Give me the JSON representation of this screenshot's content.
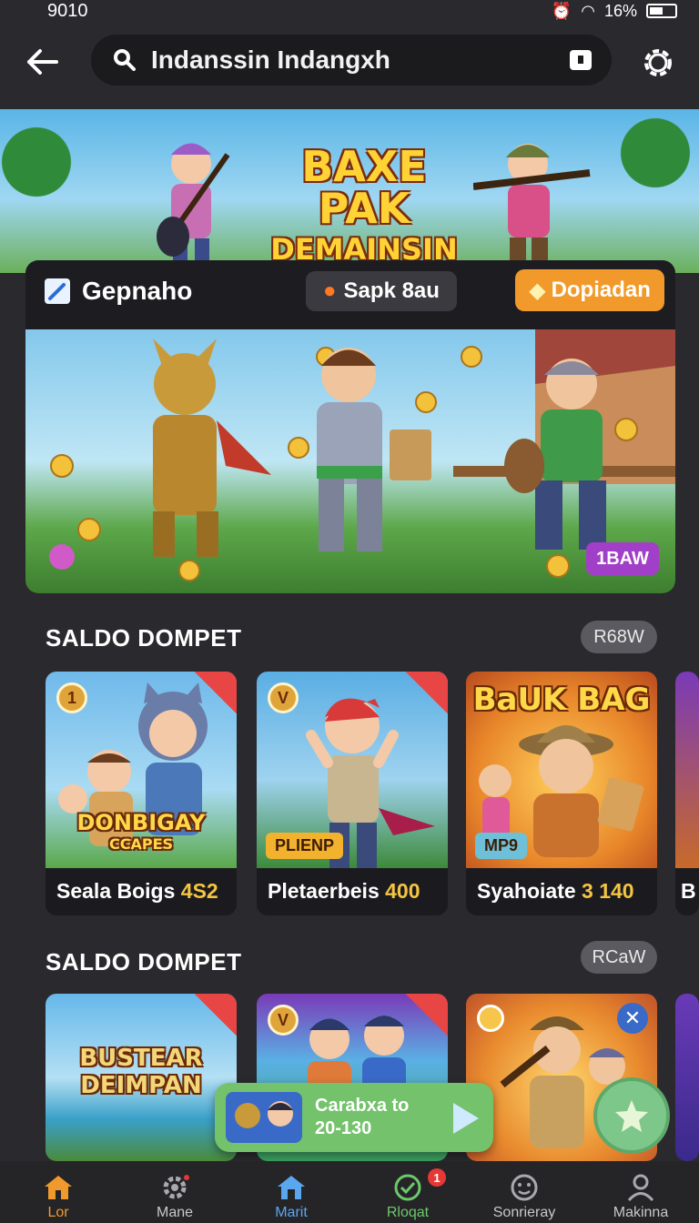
{
  "status": {
    "time": "9010",
    "battery": "16%"
  },
  "search": {
    "query": "Indanssin Indangxh"
  },
  "hero": {
    "line1": "BAXE PAK",
    "line2": "DEMAINSIN"
  },
  "feature": {
    "title": "Gepnaho",
    "chip_dark": "Sapk 8au",
    "chip_orange": "Dopiadan",
    "badge": "1BAW"
  },
  "section1": {
    "title": "SALDO DOMPET",
    "pill": "R68W",
    "cards": [
      {
        "rank": "1",
        "art_title": "DONBIGAY",
        "art_sub": "CCAPES",
        "caption": "Seala Boigs",
        "value": "4S2"
      },
      {
        "rank": "V",
        "art_label": "PLIENP",
        "caption": "Pletaerbeis",
        "value": "400"
      },
      {
        "art_title": "BaUK BAG",
        "art_label": "MP9",
        "caption": "Syahoiate",
        "value": "3 140"
      },
      {
        "caption": "B"
      }
    ]
  },
  "section2": {
    "title": "SALDO DOMPET",
    "pill": "RCaW",
    "cards": [
      {
        "art_title": "BUSTEAR",
        "art_sub": "DEIMPAN"
      },
      {
        "rank": "V"
      },
      {},
      {}
    ]
  },
  "toast": {
    "line1": "Carabxa to",
    "line2": "20-130"
  },
  "nav": [
    {
      "label": "Lor",
      "icon": "home-icon"
    },
    {
      "label": "Mane",
      "icon": "gear-icon"
    },
    {
      "label": "Marit",
      "icon": "house-icon"
    },
    {
      "label": "Rloqat",
      "icon": "check-circle-icon",
      "badge": "1"
    },
    {
      "label": "Sonrieray",
      "icon": "smiley-icon"
    },
    {
      "label": "Makinna",
      "icon": "person-icon"
    }
  ]
}
